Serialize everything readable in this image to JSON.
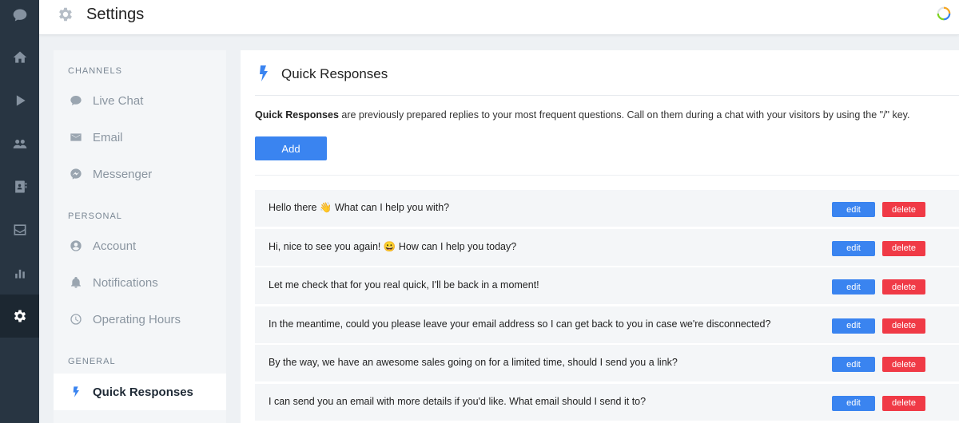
{
  "app": {
    "title": "Settings"
  },
  "rail": {
    "items": [
      {
        "icon": "chat-bubble-icon"
      },
      {
        "icon": "home-icon"
      },
      {
        "icon": "play-icon"
      },
      {
        "icon": "users-icon"
      },
      {
        "icon": "contacts-book-icon"
      },
      {
        "icon": "inbox-icon"
      },
      {
        "icon": "bar-chart-icon"
      },
      {
        "icon": "gear-icon",
        "active": true
      }
    ]
  },
  "sidebar": {
    "sections": [
      {
        "label": "CHANNELS"
      },
      {
        "label": "PERSONAL"
      },
      {
        "label": "GENERAL"
      }
    ],
    "items": [
      {
        "label": "Live Chat",
        "icon": "chat-bubble-icon"
      },
      {
        "label": "Email",
        "icon": "envelope-icon"
      },
      {
        "label": "Messenger",
        "icon": "messenger-icon"
      },
      {
        "label": "Account",
        "icon": "account-circle-icon"
      },
      {
        "label": "Notifications",
        "icon": "bell-icon"
      },
      {
        "label": "Operating Hours",
        "icon": "clock-icon"
      },
      {
        "label": "Quick Responses",
        "icon": "lightning-bolt-icon",
        "active": true
      }
    ]
  },
  "main": {
    "title": "Quick Responses",
    "intro_bold": "Quick Responses",
    "intro_rest": " are previously prepared replies to your most frequent questions. Call on them during a chat with your visitors by using the \"/\" key.",
    "add_label": "Add",
    "edit_label": "edit",
    "delete_label": "delete",
    "responses": [
      "Hello there 👋 What can I help you with?",
      "Hi, nice to see you again! 😀 How can I help you today?",
      "Let me check that for you real quick, I'll be back in a moment!",
      "In the meantime, could you please leave your email address so I can get back to you in case we're disconnected?",
      "By the way, we have an awesome sales going on for a limited time, should I send you a link?",
      "I can send you an email with more details if you'd like. What email should I send it to?"
    ]
  },
  "colors": {
    "accent": "#3a84f0",
    "danger": "#f03a46",
    "rail": "#283542"
  }
}
